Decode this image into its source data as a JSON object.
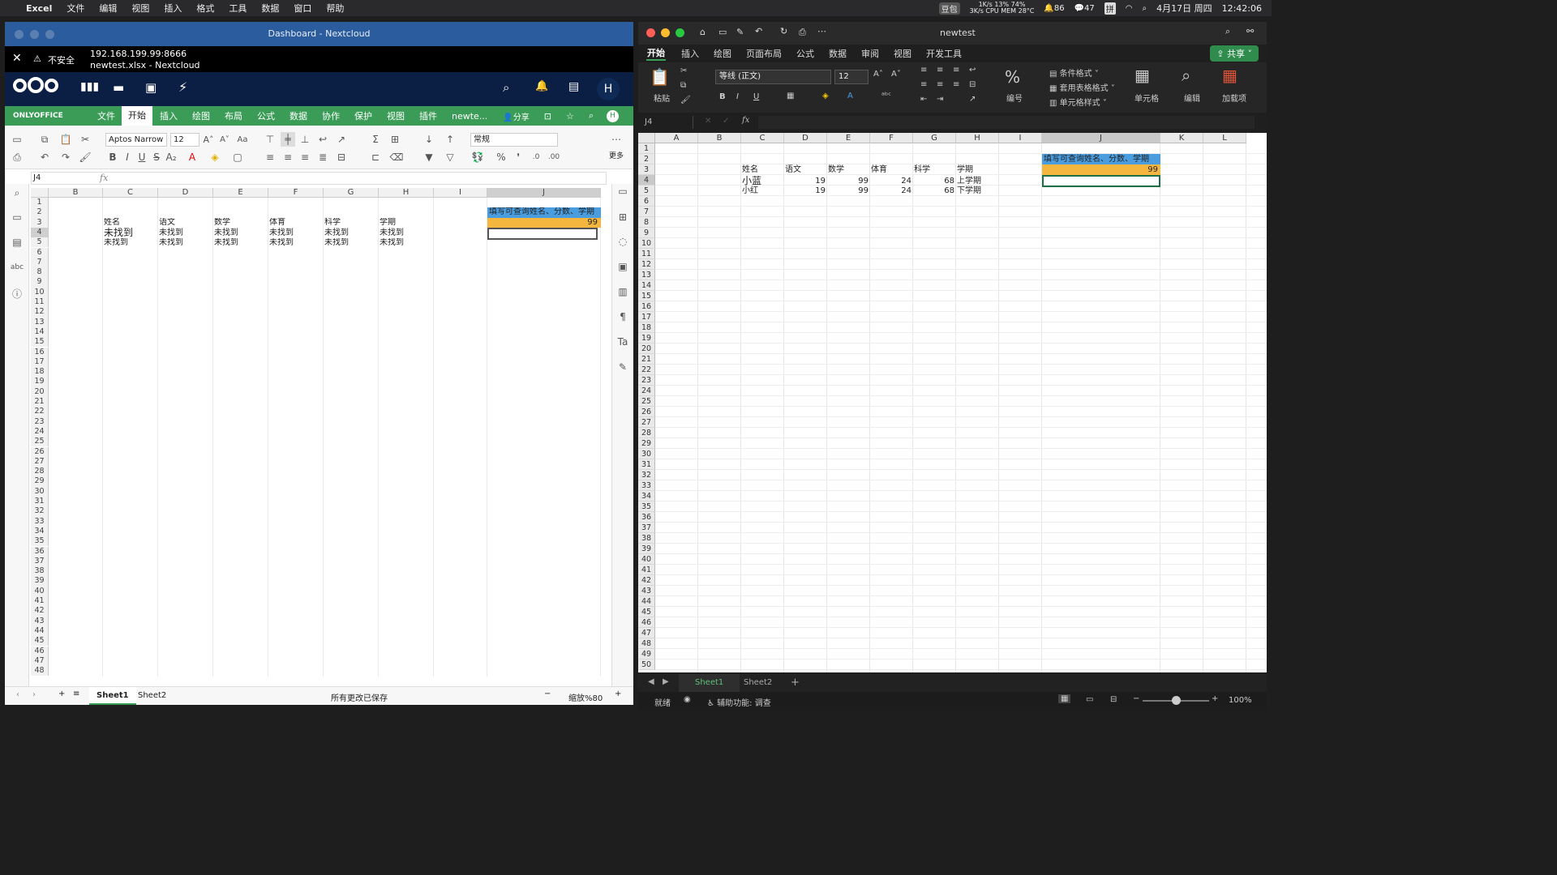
{
  "menubar": {
    "app": "Excel",
    "items": [
      "文件",
      "编辑",
      "视图",
      "插入",
      "格式",
      "工具",
      "数据",
      "窗口",
      "帮助"
    ],
    "status": [
      "豆包",
      "1K/s 13% 74%",
      "3K/s CPU MEM 28°C",
      "86",
      "47",
      "拼",
      "4月17日 周四",
      "12:42:06"
    ]
  },
  "left": {
    "title": "Dashboard - Nextcloud",
    "url": "192.168.199.99:8666",
    "subtitle": "newtest.xlsx - Nextcloud",
    "insecure": "不安全",
    "avatar": "H",
    "brand": "ONLYOFFICE",
    "tabs": [
      "文件",
      "开始",
      "插入",
      "绘图",
      "布局",
      "公式",
      "数据",
      "协作",
      "保护",
      "视图",
      "插件",
      "newte..."
    ],
    "share": "分享",
    "font": "Aptos Narrow",
    "size": "12",
    "format": "常规",
    "more": "更多",
    "namebox": "J4",
    "fx": "fx",
    "cols": [
      "B",
      "C",
      "D",
      "E",
      "F",
      "G",
      "H",
      "I",
      "J"
    ],
    "rows": [
      "1",
      "2",
      "3",
      "4",
      "5",
      "6",
      "7",
      "8",
      "9",
      "10",
      "11",
      "12",
      "13",
      "14",
      "15",
      "16",
      "17",
      "18",
      "19",
      "20",
      "21",
      "22",
      "23",
      "24",
      "25",
      "26",
      "27",
      "28",
      "29",
      "30",
      "31",
      "32",
      "33",
      "34",
      "35",
      "36",
      "37",
      "38",
      "39",
      "40",
      "41",
      "42",
      "43",
      "44",
      "45",
      "46",
      "47",
      "48"
    ],
    "headers": [
      "姓名",
      "语文",
      "数学",
      "体育",
      "科学",
      "学期"
    ],
    "r4": [
      "未找到",
      "未找到",
      "未找到",
      "未找到",
      "未找到",
      "未找到"
    ],
    "r5": [
      "未找到",
      "未找到",
      "未找到",
      "未找到",
      "未找到",
      "未找到"
    ],
    "j2": "填写可查询姓名、分数、学期",
    "j3": "99",
    "sheets": [
      "Sheet1",
      "Sheet2"
    ],
    "saved": "所有更改已保存",
    "zoom": "缩放%80"
  },
  "right": {
    "title": "newtest",
    "tabs": [
      "开始",
      "插入",
      "绘图",
      "页面布局",
      "公式",
      "数据",
      "审阅",
      "视图",
      "开发工具"
    ],
    "share": "共享",
    "paste": "粘贴",
    "font": "等线 (正文)",
    "size": "12",
    "number": "编号",
    "cond": "条件格式",
    "tablefmt": "套用表格格式",
    "cellstyle": "单元格样式",
    "cells": "单元格",
    "edit": "编辑",
    "addins": "加载项",
    "namebox": "J4",
    "fx": "fx",
    "cols": [
      "A",
      "B",
      "C",
      "D",
      "E",
      "F",
      "G",
      "H",
      "I",
      "J",
      "K",
      "L"
    ],
    "rows": [
      "1",
      "2",
      "3",
      "4",
      "5",
      "6",
      "7",
      "8",
      "9",
      "10",
      "11",
      "12",
      "13",
      "14",
      "15",
      "16",
      "17",
      "18",
      "19",
      "20",
      "21",
      "22",
      "23",
      "24",
      "25",
      "26",
      "27",
      "28",
      "29",
      "30",
      "31",
      "32",
      "33",
      "34",
      "35",
      "36",
      "37",
      "38",
      "39",
      "40",
      "41",
      "42",
      "43",
      "44",
      "45",
      "46",
      "47",
      "48",
      "49",
      "50"
    ],
    "headers": [
      "姓名",
      "语文",
      "数学",
      "体育",
      "科学",
      "学期"
    ],
    "r4": [
      "小蓝",
      "19",
      "99",
      "24",
      "68",
      "上学期"
    ],
    "r5": [
      "小红",
      "19",
      "99",
      "24",
      "68",
      "下学期"
    ],
    "j2": "填写可查询姓名、分数、学期",
    "j3": "99",
    "sheets": [
      "Sheet1",
      "Sheet2"
    ],
    "status": "就绪",
    "access": "辅助功能: 调查",
    "zoom": "100%"
  },
  "colors": {
    "blue": "#4a9ee0",
    "orange": "#f4b63f",
    "nc": "#0b1f45",
    "oo": "#3a9c57"
  }
}
